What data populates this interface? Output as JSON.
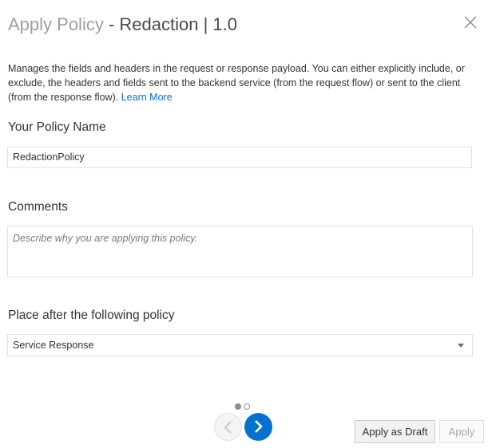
{
  "dialog": {
    "title_prefix": "Apply Policy",
    "title_main": " - Redaction | 1.0",
    "close_icon": "close-icon"
  },
  "description": {
    "text": "Manages the fields and headers in the request or response payload. You can either explicitly include, or exclude, the headers and fields sent to the backend service (from the request flow) or sent to the client (from the response flow). ",
    "link": "Learn More"
  },
  "form": {
    "policy_name_label": "Your Policy Name",
    "policy_name_value": "RedactionPolicy",
    "comments_label": "Comments",
    "comments_placeholder": "Describe why you are applying this policy.",
    "place_after_label": "Place after the following policy",
    "place_after_value": "Service Response"
  },
  "wizard": {
    "steps_total": 2,
    "current_step": 1,
    "prev_icon": "chevron-left-icon",
    "next_icon": "chevron-right-icon"
  },
  "footer": {
    "draft_label": "Apply as Draft",
    "apply_label": "Apply"
  },
  "colors": {
    "accent": "#0572ce",
    "border": "#dfe4e7",
    "text": "#333333",
    "muted_title": "#9e9e9e"
  }
}
